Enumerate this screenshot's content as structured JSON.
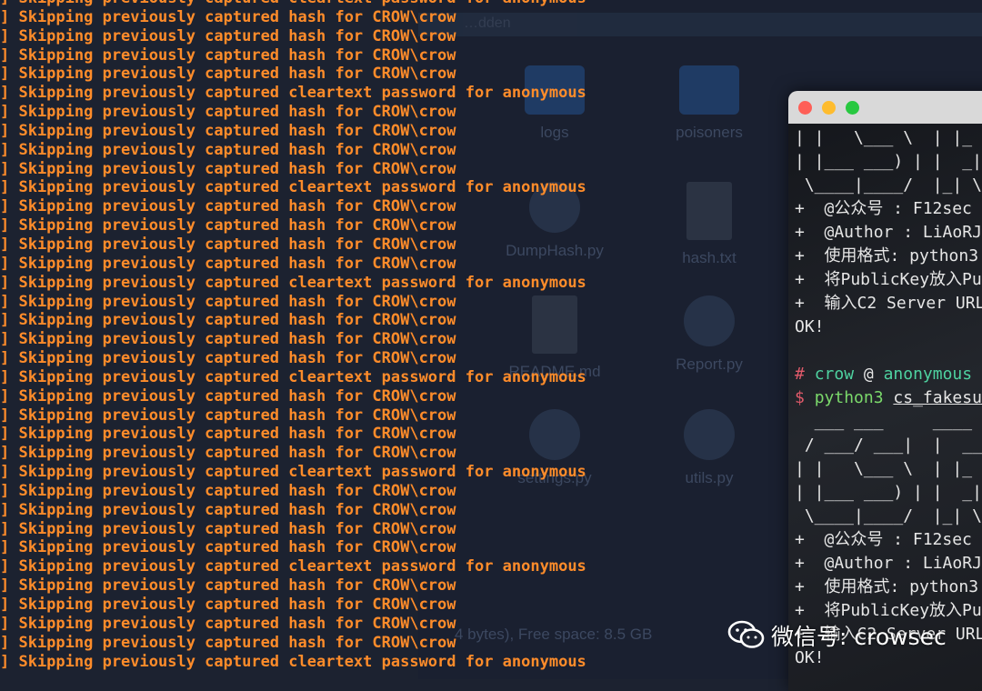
{
  "finder": {
    "header_hint": "…dden",
    "items": [
      {
        "label": "logs",
        "type": "folder"
      },
      {
        "label": "poisoners",
        "type": "folder"
      },
      {
        "label": "DumpHash.py",
        "type": "py"
      },
      {
        "label": "hash.txt",
        "type": "doc"
      },
      {
        "label": "README.md",
        "type": "doc"
      },
      {
        "label": "Report.py",
        "type": "py"
      },
      {
        "label": "settings.py",
        "type": "py"
      },
      {
        "label": "utils.py",
        "type": "py"
      }
    ],
    "status": "4 bytes), Free space: 8.5 GB"
  },
  "left_terminal": {
    "lines": [
      "] Skipping previously captured cleartext password for anonymous",
      "] Skipping previously captured hash for CROW\\crow",
      "] Skipping previously captured hash for CROW\\crow",
      "] Skipping previously captured hash for CROW\\crow",
      "] Skipping previously captured hash for CROW\\crow",
      "] Skipping previously captured cleartext password for anonymous",
      "] Skipping previously captured hash for CROW\\crow",
      "] Skipping previously captured hash for CROW\\crow",
      "] Skipping previously captured hash for CROW\\crow",
      "] Skipping previously captured hash for CROW\\crow",
      "] Skipping previously captured cleartext password for anonymous",
      "] Skipping previously captured hash for CROW\\crow",
      "] Skipping previously captured hash for CROW\\crow",
      "] Skipping previously captured hash for CROW\\crow",
      "] Skipping previously captured hash for CROW\\crow",
      "] Skipping previously captured cleartext password for anonymous",
      "] Skipping previously captured hash for CROW\\crow",
      "] Skipping previously captured hash for CROW\\crow",
      "] Skipping previously captured hash for CROW\\crow",
      "] Skipping previously captured hash for CROW\\crow",
      "] Skipping previously captured cleartext password for anonymous",
      "] Skipping previously captured hash for CROW\\crow",
      "] Skipping previously captured hash for CROW\\crow",
      "] Skipping previously captured hash for CROW\\crow",
      "] Skipping previously captured hash for CROW\\crow",
      "] Skipping previously captured cleartext password for anonymous",
      "] Skipping previously captured hash for CROW\\crow",
      "] Skipping previously captured hash for CROW\\crow",
      "] Skipping previously captured hash for CROW\\crow",
      "] Skipping previously captured hash for CROW\\crow",
      "] Skipping previously captured cleartext password for anonymous",
      "] Skipping previously captured hash for CROW\\crow",
      "] Skipping previously captured hash for CROW\\crow",
      "] Skipping previously captured hash for CROW\\crow",
      "] Skipping previously captured hash for CROW\\crow",
      "] Skipping previously captured cleartext password for anonymous"
    ]
  },
  "right_terminal": {
    "lines": [
      {
        "text": "| |   \\___ \\  | |_ /",
        "color": "default"
      },
      {
        "text": "| |___ ___) | |  _|",
        "color": "default"
      },
      {
        "text": " \\____|____/  |_| \\",
        "color": "default"
      },
      {
        "text": "+  @公众号 : F12sec",
        "color": "default"
      },
      {
        "text": "+  @Author : LiAoRJ",
        "color": "default"
      },
      {
        "text": "+  使用格式: python3",
        "color": "default"
      },
      {
        "text": "+  将PublicKey放入Pu",
        "color": "default"
      },
      {
        "text": "+  输入C2 Server URL",
        "color": "default"
      },
      {
        "text": "OK!",
        "color": "default"
      },
      {
        "text": "",
        "color": "default"
      },
      {
        "text": "PROMPT",
        "color": "prompt"
      },
      {
        "text": "CMD",
        "color": "cmd"
      },
      {
        "text": "  ___ ___     ____",
        "color": "default"
      },
      {
        "text": " / ___/ ___|  |  __",
        "color": "default"
      },
      {
        "text": "| |   \\___ \\  | |_ /",
        "color": "default"
      },
      {
        "text": "| |___ ___) | |  _|",
        "color": "default"
      },
      {
        "text": " \\____|____/  |_| \\",
        "color": "default"
      },
      {
        "text": "+  @公众号 : F12sec",
        "color": "default"
      },
      {
        "text": "+  @Author : LiAoRJ",
        "color": "default"
      },
      {
        "text": "+  使用格式: python3",
        "color": "default"
      },
      {
        "text": "+  将PublicKey放入Pu",
        "color": "default"
      },
      {
        "text": "+  输入C2 Server URL",
        "color": "default"
      },
      {
        "text": "OK!",
        "color": "default"
      }
    ],
    "prompt": {
      "hash": "#",
      "user": "crow",
      "at": "@",
      "host": "anonymous",
      "rest": "i"
    },
    "command": {
      "dollar": "$",
      "cmd": "python3",
      "arg": "cs_fakesub"
    }
  },
  "watermark": {
    "text": "微信号: crowsec",
    "icon": "wechat-icon"
  },
  "colors": {
    "orange": "#ff8c2a",
    "prompt_red": "#e05a6a",
    "user_green": "#4ed2a0"
  }
}
